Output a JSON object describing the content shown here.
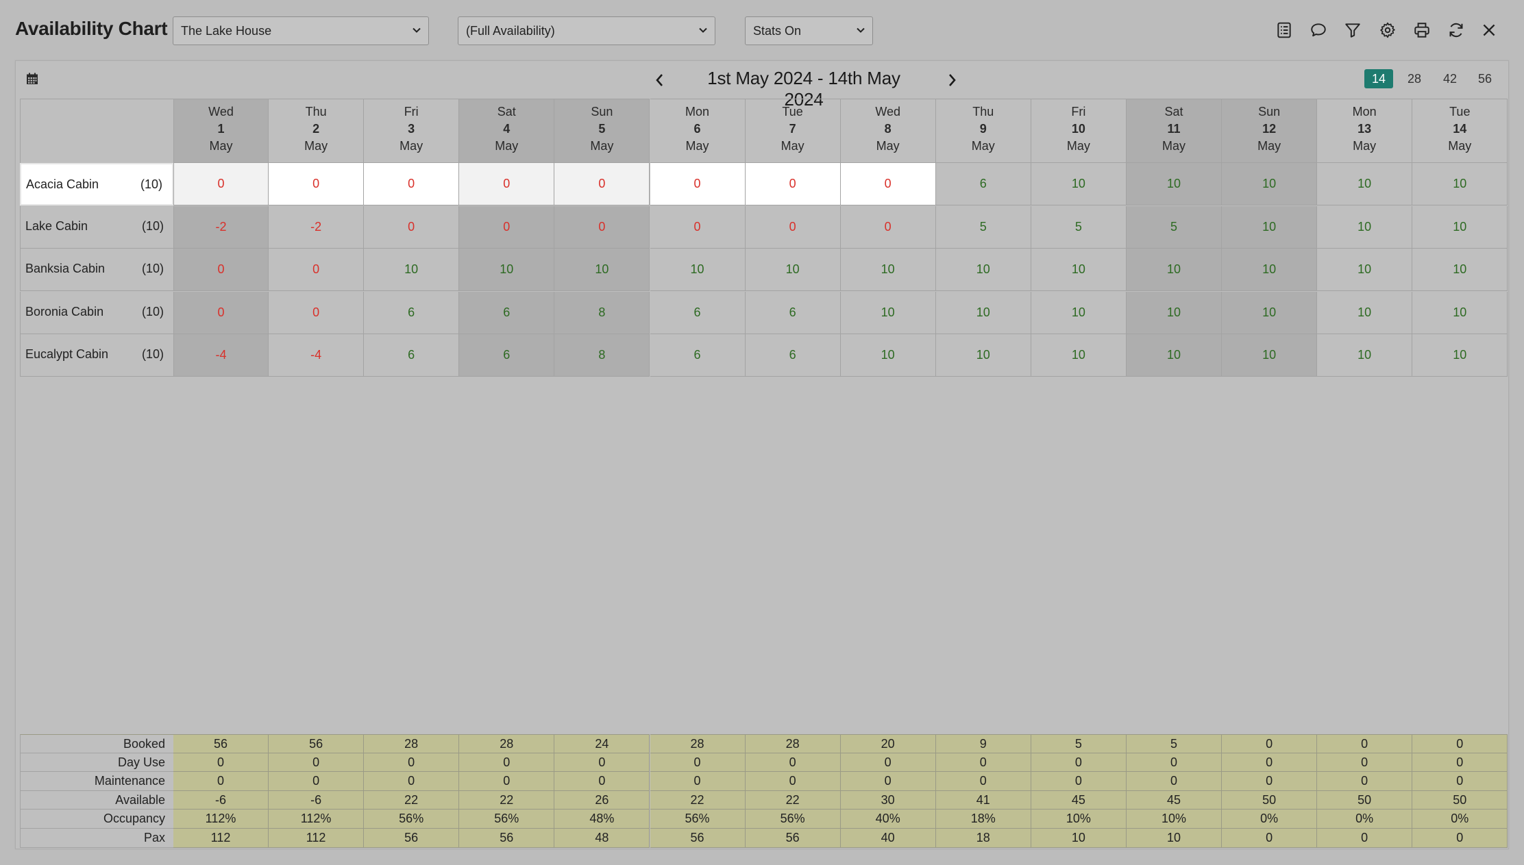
{
  "header": {
    "title": "Availability Chart",
    "property_select": "The Lake House",
    "availability_select": "(Full Availability)",
    "stats_select": "Stats On",
    "icons": [
      "list-icon",
      "comment-icon",
      "filter-icon",
      "gear-icon",
      "print-icon",
      "refresh-icon",
      "close-icon"
    ]
  },
  "nav": {
    "date_range": "1st May 2024 - 14th May 2024",
    "range_options": [
      "14",
      "28",
      "42",
      "56"
    ],
    "active_range": "14"
  },
  "days": [
    {
      "dow": "Wed",
      "d": "1",
      "m": "May"
    },
    {
      "dow": "Thu",
      "d": "2",
      "m": "May"
    },
    {
      "dow": "Fri",
      "d": "3",
      "m": "May"
    },
    {
      "dow": "Sat",
      "d": "4",
      "m": "May"
    },
    {
      "dow": "Sun",
      "d": "5",
      "m": "May"
    },
    {
      "dow": "Mon",
      "d": "6",
      "m": "May"
    },
    {
      "dow": "Tue",
      "d": "7",
      "m": "May"
    },
    {
      "dow": "Wed",
      "d": "8",
      "m": "May"
    },
    {
      "dow": "Thu",
      "d": "9",
      "m": "May"
    },
    {
      "dow": "Fri",
      "d": "10",
      "m": "May"
    },
    {
      "dow": "Sat",
      "d": "11",
      "m": "May"
    },
    {
      "dow": "Sun",
      "d": "12",
      "m": "May"
    },
    {
      "dow": "Mon",
      "d": "13",
      "m": "May"
    },
    {
      "dow": "Tue",
      "d": "14",
      "m": "May"
    }
  ],
  "rooms": [
    {
      "name": "Acacia Cabin",
      "count": "(10)",
      "values": [
        "0",
        "0",
        "0",
        "0",
        "0",
        "0",
        "0",
        "0",
        "6",
        "10",
        "10",
        "10",
        "10",
        "10"
      ]
    },
    {
      "name": "Lake Cabin",
      "count": "(10)",
      "values": [
        "-2",
        "-2",
        "0",
        "0",
        "0",
        "0",
        "0",
        "0",
        "5",
        "5",
        "5",
        "10",
        "10",
        "10"
      ]
    },
    {
      "name": "Banksia Cabin",
      "count": "(10)",
      "values": [
        "0",
        "0",
        "10",
        "10",
        "10",
        "10",
        "10",
        "10",
        "10",
        "10",
        "10",
        "10",
        "10",
        "10"
      ]
    },
    {
      "name": "Boronia Cabin",
      "count": "(10)",
      "values": [
        "0",
        "0",
        "6",
        "6",
        "8",
        "6",
        "6",
        "10",
        "10",
        "10",
        "10",
        "10",
        "10",
        "10"
      ]
    },
    {
      "name": "Eucalypt Cabin",
      "count": "(10)",
      "values": [
        "-4",
        "-4",
        "6",
        "6",
        "8",
        "6",
        "6",
        "10",
        "10",
        "10",
        "10",
        "10",
        "10",
        "10"
      ]
    }
  ],
  "stats": [
    {
      "label": "Booked",
      "values": [
        "56",
        "56",
        "28",
        "28",
        "24",
        "28",
        "28",
        "20",
        "9",
        "5",
        "5",
        "0",
        "0",
        "0"
      ]
    },
    {
      "label": "Day Use",
      "values": [
        "0",
        "0",
        "0",
        "0",
        "0",
        "0",
        "0",
        "0",
        "0",
        "0",
        "0",
        "0",
        "0",
        "0"
      ]
    },
    {
      "label": "Maintenance",
      "values": [
        "0",
        "0",
        "0",
        "0",
        "0",
        "0",
        "0",
        "0",
        "0",
        "0",
        "0",
        "0",
        "0",
        "0"
      ]
    },
    {
      "label": "Available",
      "values": [
        "-6",
        "-6",
        "22",
        "22",
        "26",
        "22",
        "22",
        "30",
        "41",
        "45",
        "45",
        "50",
        "50",
        "50"
      ]
    },
    {
      "label": "Occupancy",
      "values": [
        "112%",
        "112%",
        "56%",
        "56%",
        "48%",
        "56%",
        "56%",
        "40%",
        "18%",
        "10%",
        "10%",
        "0%",
        "0%",
        "0%"
      ]
    },
    {
      "label": "Pax",
      "values": [
        "112",
        "112",
        "56",
        "56",
        "48",
        "56",
        "56",
        "40",
        "18",
        "10",
        "10",
        "0",
        "0",
        "0"
      ]
    }
  ],
  "colors": {
    "negative": "#d9302a",
    "positive": "#2d6a22",
    "accent": "#1e7b6f",
    "stats_bg": "#bfbf93"
  }
}
